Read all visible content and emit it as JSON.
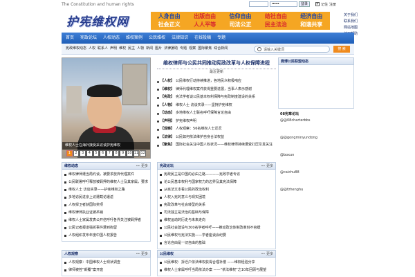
{
  "top": {
    "tagline": "The Constitution and human rights",
    "login_button": "登录",
    "checkbox_mark": "✔",
    "remember_label": "记住",
    "register_label": "注册",
    "password_mask": "••••••"
  },
  "logo": {
    "text": "护宪维权网"
  },
  "banner": {
    "slogans": [
      "人身自由",
      "出版自由",
      "信仰自由",
      "结社自由",
      "经济自由",
      "社会正义",
      "人人平等",
      "司法公正",
      "民主法治",
      "和谐共享"
    ]
  },
  "side_links": [
    "关于我们",
    "联系我们",
    "网站地图",
    "使用帮助"
  ],
  "nav": {
    "items": [
      "首页",
      "宪政论坛",
      "人权动态",
      "维权案例",
      "公民维权",
      "法律知识",
      "在线投稿",
      "专题"
    ]
  },
  "subnav": {
    "items": [
      "宪政维权动态",
      "人权",
      "联系人",
      "声明",
      "维权",
      "民主",
      "人物",
      "新闻",
      "图片",
      "法律援助",
      "专题",
      "观察",
      "国际聚焦",
      "综合新闻"
    ]
  },
  "search": {
    "placeholder": "请输入关键词",
    "button": "搜 索"
  },
  "photo": {
    "caption": "维权人士在海外接受采访谈护宪维权",
    "pages": [
      "1",
      "2",
      "3",
      "4",
      "5",
      "6",
      "7",
      "8",
      "9",
      "10",
      "11",
      "12"
    ]
  },
  "headline": {
    "title": "维权律师与公民共同推动宪政改革与人权保障进程",
    "subtitle": "最近更新",
    "items": [
      {
        "tag": "【人权】",
        "text": "公民维权行动持续推进，各地民众积极响应"
      },
      {
        "tag": "【维权】",
        "text": "律师代理维权案件获得重要进展，当事人表示感谢"
      },
      {
        "tag": "【宪政】",
        "text": "宪法学者谈公民基本权利保障与宪政制度建设的关系"
      },
      {
        "tag": "【人物】",
        "text": "维权人士 访谈实录——坚持护宪维权"
      },
      {
        "tag": "【动态】",
        "text": "多地维权人士联名呼吁保障言论自由"
      },
      {
        "tag": "【声明】",
        "text": "护宪维权声明"
      },
      {
        "tag": "【观察】",
        "text": "人权观察：56名维权人士近况"
      },
      {
        "tag": "【法律】",
        "text": "公民如何依法维护自身合法权益"
      },
      {
        "tag": "【聚焦】",
        "text": "国际社会关注中国人权状况——维权律师持续遭受打压引发关注"
      }
    ]
  },
  "right": {
    "panel_title": "微博公民联盟动态",
    "accounts": [
      {
        "title": "08宪章论坛",
        "handle": "@@08charterbbs"
      },
      {
        "title": "公民运动",
        "handle": "@@gongminyundong"
      },
      {
        "title": "博讯",
        "handle": "@boxun"
      },
      {
        "title": "蔡楚",
        "handle": "@caichu88"
      },
      {
        "title": "自由圣火",
        "handle": "@@fzhenghu"
      }
    ]
  },
  "panels": {
    "left1": {
      "title": "维权动态",
      "more": "更多",
      "items": [
        "维权律师遭当局约谈，被要求放弃代理案件",
        "公民联署呼吁释放被羁押的维权人士及其家属，要求依法公正审理案件",
        "维权人士 访谈实录——护宪维权之路",
        "多地访民进京上访遭截访遣返",
        "人权捍卫者获国际奖项",
        "维权律师执业证被吊销",
        "维权人士家属发表公开信呼吁各界关注被羁押者",
        "公民记者报道强拆事件遭到拘留",
        "人权组织发布年度中国人权报告"
      ]
    },
    "mid1": {
      "title": "宪政论坛",
      "more": "更多",
      "items": [
        "宪政民主是中国的必由之路————宪政学者专访",
        "论公民基本权利与国家权力的边界及其宪法保障",
        "从宪法文本看公民的政治权利",
        "人权入宪的意义与现实困境",
        "宪政改革与社会转型的关系",
        "司法独立是法治的基础与保障",
        "维权运动的历史与未来走向",
        "公民社会建设与300名学者呼吁——推动政治体制改革刻不容缓",
        "公民维权与宪法实施——学者座谈会纪要",
        "言论自由是一切自由的基础"
      ]
    },
    "left2": {
      "title": "人权观察",
      "more": "更多",
      "items": [
        "人权观察：中国维权人士现状调查",
        "律师被控“颠覆”案开庭"
      ]
    },
    "mid2": {
      "title": "公民维权",
      "more": "更多",
      "items": [
        "公民维权：拆迁户依法维权获得合理补偿 ——维权经验分享",
        "维权人士家属呼吁当局依法办案 ——“依法维权”之10年回顾与展望"
      ]
    }
  }
}
